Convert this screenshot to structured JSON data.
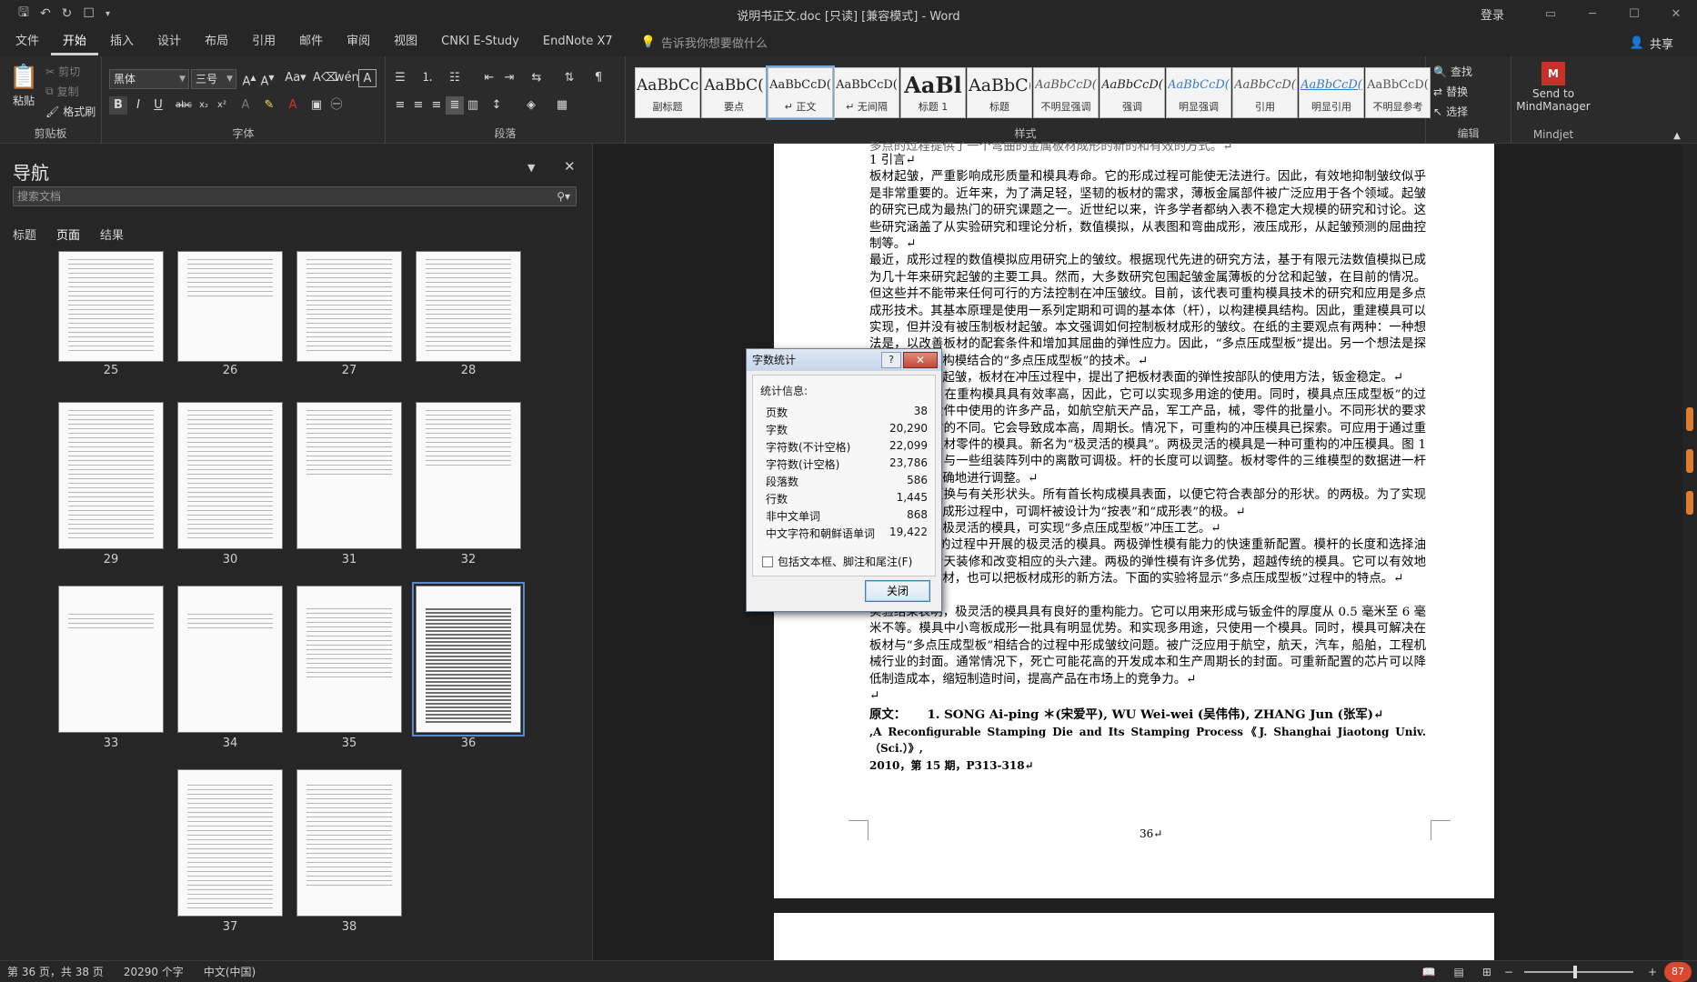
{
  "titlebar": {
    "title": "说明书正文.doc [只读] [兼容模式] - Word",
    "login": "登录",
    "qa_icons": [
      "save-icon",
      "undo-icon",
      "redo-icon",
      "touch-mode-icon",
      "customize-icon"
    ]
  },
  "tabs": [
    "文件",
    "开始",
    "插入",
    "设计",
    "布局",
    "引用",
    "邮件",
    "审阅",
    "视图",
    "CNKI E-Study",
    "EndNote X7"
  ],
  "active_tab": "开始",
  "tellme": "告诉我你想要做什么",
  "share": "共享",
  "ribbon": {
    "clipboard": {
      "label": "剪贴板",
      "paste": "粘贴",
      "cut": "剪切",
      "copy": "复制",
      "format_painter": "格式刷"
    },
    "font": {
      "label": "字体",
      "font_name": "黑体",
      "font_size": "三号"
    },
    "paragraph": {
      "label": "段落"
    },
    "styles": {
      "label": "样式",
      "items": [
        {
          "preview": "AaBbCc",
          "name": "副标题"
        },
        {
          "preview": "AaBbC(",
          "name": "要点"
        },
        {
          "preview": "AaBbCcD(",
          "name": "↵ 正文"
        },
        {
          "preview": "AaBbCcD(",
          "name": "↵ 无间隔"
        },
        {
          "preview": "AaBl",
          "name": "标题 1"
        },
        {
          "preview": "AaBbC(",
          "name": "标题"
        },
        {
          "preview": "AaBbCcD(",
          "name": "不明显强调"
        },
        {
          "preview": "AaBbCcD(",
          "name": "强调"
        },
        {
          "preview": "AaBbCcD(",
          "name": "明显强调"
        },
        {
          "preview": "AaBbCcD(",
          "name": "引用"
        },
        {
          "preview": "AaBbCcD(",
          "name": "明显引用"
        },
        {
          "preview": "AaBbCcD(",
          "name": "不明显参考"
        }
      ]
    },
    "editing": {
      "label": "编辑",
      "find": "查找",
      "replace": "替换",
      "select": "选择"
    },
    "mindjet": {
      "label": "Mindjet",
      "send": "Send to MindManager"
    }
  },
  "nav": {
    "title": "导航",
    "search_placeholder": "搜索文档",
    "tabs": [
      "标题",
      "页面",
      "结果"
    ],
    "active_tab": "页面",
    "pages": [
      "25",
      "26",
      "27",
      "28",
      "29",
      "30",
      "31",
      "32",
      "33",
      "34",
      "35",
      "36",
      "37",
      "38"
    ],
    "selected_page": "36"
  },
  "doc": {
    "top_line": "多点的过程提供了一个弯曲的金属板材成形的新的和有效的方式。↵",
    "paragraphs": [
      "1 引言↵",
      "板材起皱，严重影响成形质量和模具寿命。它的形成过程可能使无法进行。因此，有效地抑制皱纹似乎是非常重要的。近年来，为了满足轻，坚韧的板材的需求，薄板金属部件被广泛应用于各个领域。起皱的研究已成为最热门的研究课题之一。近世纪以来，许多学者都纳入表不稳定大规模的研究和讨论。这些研究涵盖了从实验研究和理论分析，数值模拟，从表图和弯曲成形，液压成形，从起皱预测的屈曲控制等。↵",
      "最近，成形过程的数值模拟应用研究上的皱纹。根据现代先进的研究方法，基于有限元法数值模拟已成为几十年来研究起皱的主要工具。然而，大多数研究包围起皱金属薄板的分岔和起皱，在目前的情况。但这些并不能带来任何可行的方法控制在冲压皱纹。目前，该代表可重构模具技术的研究和应用是多点成形技术。其基本原理是使用一系列定期和可调的基本体（杆），以构建模具结构。因此，重建模具可以实现，但并没有被压制板材起皱。本文强调如何控制板材成形的皱纹。在纸的主要观点有两种：一种想法是，以改善板材的配套条件和增加其屈曲的弹性应力。因此，“多点压成型板”提出。另一个想法是探索出一条可重构模结合的“多点压成型板”的技术。↵",
      "切，为了减少起皱，板材在冲压过程中，提出了把板材表面的弹性按部队的使用方法，钣金稳定。↵",
      "构模具开发。在重构模具具有效率高，因此，它可以实现多用途的使用。同时，模具点压成型板”的过程。弧形钣金件中使用的许多产品，如航空航天产品，军工产品，械，零件的批量小。不同形状的要求压铸成型板材的不同。它会导致成本高，周期长。情况下，可重构的冲压模具已探索。可应用于通过重新形成各种板材零件的模具。新名为“极灵活的模具”。两极灵活的模具是一种可重构的冲压模具。图 1 显示的结构。与一些组装阵列中的离散可调极。杆的长度可以调整。板材零件的三维模型的数据进一杆的长度可以准确地进行调整。↵",
      "的冲头可以更换与有关形状头。所有首长构成模具表面，以便它符合表部分的形状。的两极。为了实现多点按和板材成形过程中，可调杆被设计为“按表”和“成形表”的极。↵",
      "多点压成型板极灵活的模具，可实现“多点压成型板”冲压工艺。↵",
      "点压成型板”的过程中开展的极灵活的模具。两极弹性模有能力的快速重新配置。模杆的长度和选择油子，极适合看天装修和改变相应的头六建。两极的弹性模有许多优势，超越传统的模具。它可以有效地抑制皱纹的板材，也可以把板材成形的新方法。下面的实验将显示“多点压成型板”过程中的特点。↵",
      "5 结论↵",
      "实验结果表明，极灵活的模具具有良好的重构能力。它可以用来形成与钣金件的厚度从 0.5 毫米至 6 毫米不等。模具中小弯板成形一批具有明显优势。和实现多用途，只使用一个模具。同时，模具可解决在板材与“多点压成型板”相结合的过程中形成皱纹问题。被广泛应用于航空，航天，汽车，船舶，工程机械行业的封面。通常情况下，死亡可能花高的开发成本和生产周期长的封面。可重新配置的芯片可以降低制造成本，缩短制造时间，提高产品在市场上的竞争力。↵",
      "↵"
    ],
    "ref_label": "原文：",
    "ref_line1": "1. SONG Ai-ping ＊(宋爱平), WU Wei-wei (吴伟伟), ZHANG Jun (张军)↵",
    "ref_line2": ",A Reconfigurable Stamping Die and Its Stamping Process《J. Shanghai Jiaotong Univ.（Sci.）》,",
    "ref_line3": "2010，第 15 期，P313-318↵",
    "page_number": "36↵"
  },
  "dialog": {
    "title": "字数统计",
    "help": "?",
    "section": "统计信息:",
    "stats": [
      {
        "label": "页数",
        "value": "38"
      },
      {
        "label": "字数",
        "value": "20,290"
      },
      {
        "label": "字符数(不计空格)",
        "value": "22,099"
      },
      {
        "label": "字符数(计空格)",
        "value": "23,786"
      },
      {
        "label": "段落数",
        "value": "586"
      },
      {
        "label": "行数",
        "value": "1,445"
      },
      {
        "label": "非中文单词",
        "value": "868"
      },
      {
        "label": "中文字符和朝鲜语单词",
        "value": "19,422"
      }
    ],
    "checkbox": "包括文本框、脚注和尾注(F)",
    "close": "关闭"
  },
  "status": {
    "page": "第 36 页，共 38 页",
    "words": "20290 个字",
    "lang": "中文(中国)",
    "badge": "87"
  }
}
